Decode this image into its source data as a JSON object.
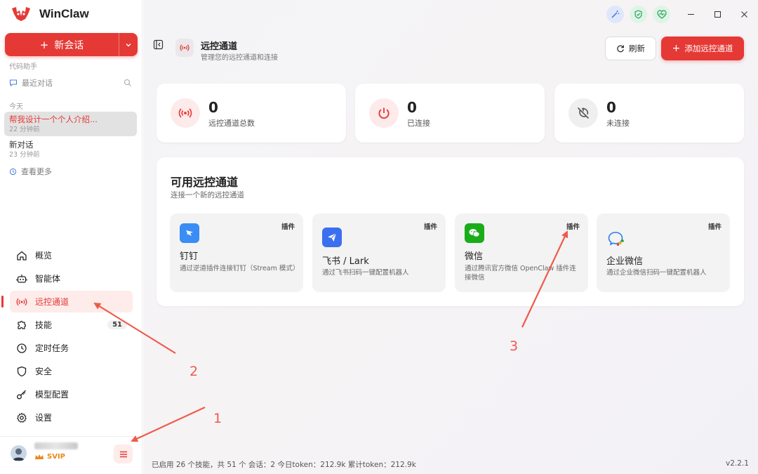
{
  "app": {
    "name": "WinClaw",
    "brand_color": "#e53935"
  },
  "sidebar": {
    "new_chat": {
      "label": "新会话"
    },
    "section_label": "代码助手",
    "recent_label": "最近对话",
    "today_label": "今天",
    "conversations": [
      {
        "title": "帮我设计一个个人介绍...",
        "time": "22 分钟前",
        "active": true
      },
      {
        "title": "新对话",
        "time": "23 分钟前",
        "active": false
      }
    ],
    "see_more": "查看更多",
    "nav": [
      {
        "label": "概览",
        "icon": "home-icon"
      },
      {
        "label": "智能体",
        "icon": "robot-icon"
      },
      {
        "label": "远控通道",
        "icon": "broadcast-icon",
        "active": true
      },
      {
        "label": "技能",
        "icon": "puzzle-icon",
        "badge": "51"
      },
      {
        "label": "定时任务",
        "icon": "clock-icon"
      },
      {
        "label": "安全",
        "icon": "shield-icon"
      },
      {
        "label": "模型配置",
        "icon": "key-icon"
      },
      {
        "label": "设置",
        "icon": "gear-icon"
      }
    ],
    "user": {
      "tier": "SVIP"
    }
  },
  "header": {
    "title": "远控通道",
    "subtitle": "管理您的远控通道和连接",
    "refresh_label": "刷新",
    "add_label": "添加远控通道"
  },
  "stats": [
    {
      "value": "0",
      "label": "远控通道总数",
      "icon": "broadcast-icon"
    },
    {
      "value": "0",
      "label": "已连接",
      "icon": "power-icon"
    },
    {
      "value": "0",
      "label": "未连接",
      "icon": "disconnected-icon"
    }
  ],
  "channels": {
    "title": "可用远控通道",
    "subtitle": "连接一个新的远控通道",
    "items": [
      {
        "name": "钉钉",
        "tag": "插件",
        "desc": "通过逆道插件连接钉钉（Stream 模式）",
        "icon": "dingtalk-icon",
        "color": "#3a8df5"
      },
      {
        "name": "飞书 / Lark",
        "tag": "插件",
        "desc": "通过飞书扫码一键配置机器人",
        "icon": "lark-icon",
        "color": "#3b6ff0"
      },
      {
        "name": "微信",
        "tag": "插件",
        "desc": "通过腾讯官方微信 OpenClaw 插件连接微信",
        "icon": "wechat-icon",
        "color": "#1aad19"
      },
      {
        "name": "企业微信",
        "tag": "插件",
        "desc": "通过企业微信扫码一键配置机器人",
        "icon": "wecom-icon",
        "color": "#2b7de9"
      }
    ]
  },
  "footer": {
    "status": "已启用 26 个技能，共 51 个   会话：2   今日token：212.9k   累计token：212.9k",
    "version": "v2.2.1"
  },
  "annotations": [
    "1",
    "2",
    "3"
  ]
}
